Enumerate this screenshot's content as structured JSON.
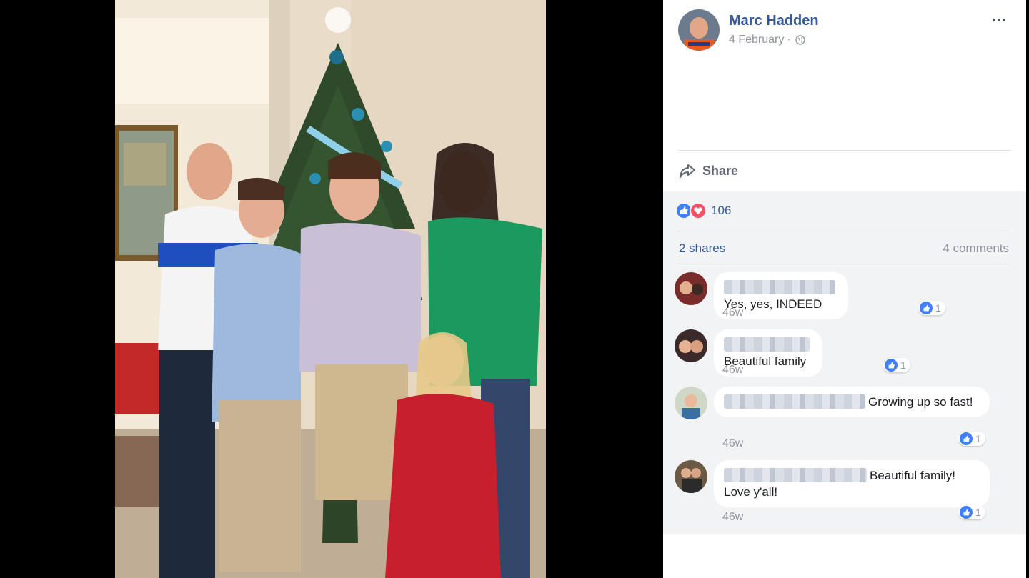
{
  "post": {
    "author": "Marc Hadden",
    "date": "4 February",
    "separator": "·",
    "privacy_icon": "globe-icon",
    "more_icon": "more-horizontal-icon"
  },
  "actions": {
    "share_label": "Share",
    "share_icon": "share-arrow-icon"
  },
  "reactions": {
    "types": [
      "like",
      "love"
    ],
    "count": "106"
  },
  "stats": {
    "shares": "2 shares",
    "comments": "4 comments"
  },
  "comments": [
    {
      "text": "Yes, yes, INDEED",
      "time": "46w",
      "likes": "1"
    },
    {
      "text": "Beautiful family",
      "time": "46w",
      "likes": "1"
    },
    {
      "text": "Growing up so fast!",
      "time": "46w",
      "likes": "1"
    },
    {
      "text": "Beautiful family! Love y'all!",
      "time": "46w",
      "likes": "1"
    }
  ],
  "colors": {
    "link": "#365899",
    "like": "#4080ff",
    "love": "#f25268",
    "panel_bg": "#f2f3f5"
  }
}
